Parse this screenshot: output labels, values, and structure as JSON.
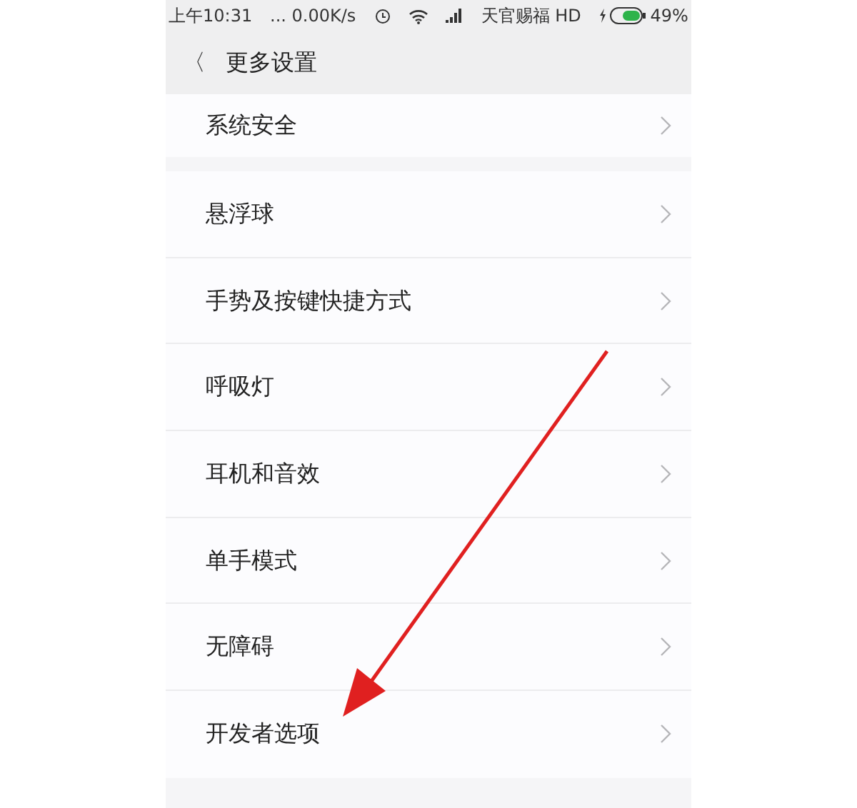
{
  "status_bar": {
    "time": "上午10:31",
    "speed": "... 0.00K/s",
    "carrier": "天官赐福 HD",
    "battery": "49%"
  },
  "header": {
    "back": "〈",
    "title": "更多设置"
  },
  "sections": [
    {
      "items": [
        "系统安全"
      ]
    },
    {
      "items": [
        "悬浮球",
        "手势及按键快捷方式",
        "呼吸灯",
        "耳机和音效",
        "单手模式",
        "无障碍",
        "开发者选项"
      ]
    }
  ]
}
